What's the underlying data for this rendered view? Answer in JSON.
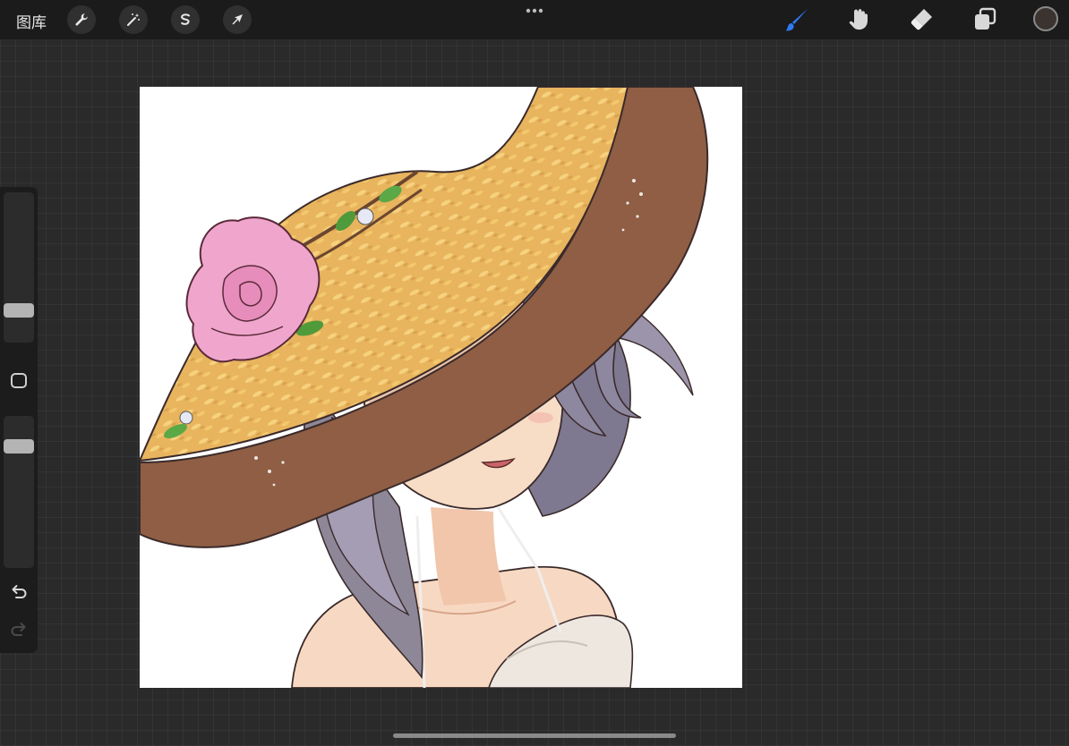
{
  "toolbar": {
    "gallery_label": "图库",
    "left_tools": [
      "wrench-icon",
      "magic-wand-icon",
      "selection-icon",
      "transform-arrow-icon"
    ],
    "right_tools": [
      "brush-icon",
      "smudge-icon",
      "eraser-icon",
      "layers-icon"
    ],
    "active_tool": "brush",
    "current_color": "#3a3330",
    "accent_color": "#2f7bf5"
  },
  "sidebar": {
    "brush_size_level": 0.25,
    "opacity_level": 0.78,
    "undo_enabled": true,
    "redo_enabled": false
  },
  "canvas": {
    "background": "#ffffff",
    "subject": "girl-with-straw-hat-illustration"
  }
}
